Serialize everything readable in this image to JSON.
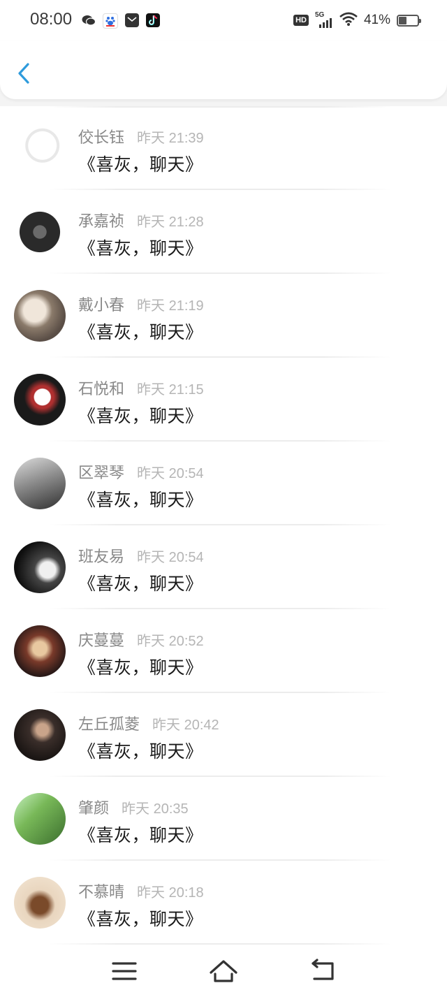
{
  "status_bar": {
    "time": "08:00",
    "apps": [
      "wechat-icon",
      "baidu-icon",
      "mail-icon",
      "tiktok-icon"
    ],
    "hd_label": "HD",
    "network_label": "5G",
    "battery_percent": "41%",
    "battery_level": 0.41
  },
  "header": {
    "back_icon": "chevron-left-icon",
    "accent": "#2e9bdc"
  },
  "messages": [
    {
      "name": "佼长钰",
      "time": "昨天 21:39",
      "text": "《喜灰，聊天》"
    },
    {
      "name": "承嘉祯",
      "time": "昨天 21:28",
      "text": "《喜灰，聊天》"
    },
    {
      "name": "戴小春",
      "time": "昨天 21:19",
      "text": "《喜灰，聊天》"
    },
    {
      "name": "石悦和",
      "time": "昨天 21:15",
      "text": "《喜灰，聊天》"
    },
    {
      "name": "区翠琴",
      "time": "昨天 20:54",
      "text": "《喜灰，聊天》"
    },
    {
      "name": "班友易",
      "time": "昨天 20:54",
      "text": "《喜灰，聊天》"
    },
    {
      "name": "庆蔓蔓",
      "time": "昨天 20:52",
      "text": "《喜灰，聊天》"
    },
    {
      "name": "左丘孤菱",
      "time": "昨天 20:42",
      "text": "《喜灰，聊天》"
    },
    {
      "name": "肇颜",
      "time": "昨天 20:35",
      "text": "《喜灰，聊天》"
    },
    {
      "name": "不慕晴",
      "time": "昨天 20:18",
      "text": "《喜灰，聊天》"
    }
  ],
  "nav_bar": {
    "menu_icon": "menu-icon",
    "home_icon": "home-icon",
    "back_icon": "back-arrow-icon"
  }
}
